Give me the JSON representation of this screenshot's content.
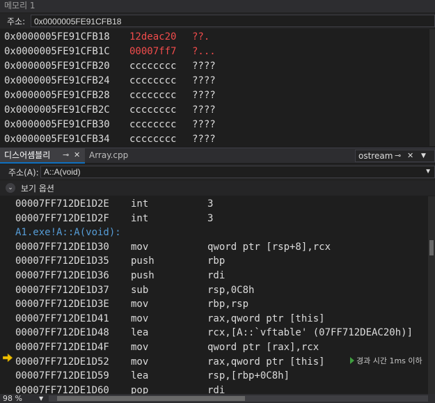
{
  "memory": {
    "title": "메모리 1",
    "address_label": "주소:",
    "address_value": "0x0000005FE91CFB18",
    "rows": [
      {
        "addr": "0x0000005FE91CFB18",
        "hex": "12deac20",
        "ascii": "??.",
        "red": true
      },
      {
        "addr": "0x0000005FE91CFB1C",
        "hex": "00007ff7",
        "ascii": "?...",
        "red": true
      },
      {
        "addr": "0x0000005FE91CFB20",
        "hex": "cccccccc",
        "ascii": "????",
        "red": false
      },
      {
        "addr": "0x0000005FE91CFB24",
        "hex": "cccccccc",
        "ascii": "????",
        "red": false
      },
      {
        "addr": "0x0000005FE91CFB28",
        "hex": "cccccccc",
        "ascii": "????",
        "red": false
      },
      {
        "addr": "0x0000005FE91CFB2C",
        "hex": "cccccccc",
        "ascii": "????",
        "red": false
      },
      {
        "addr": "0x0000005FE91CFB30",
        "hex": "cccccccc",
        "ascii": "????",
        "red": false
      },
      {
        "addr": "0x0000005FE91CFB34",
        "hex": "cccccccc",
        "ascii": "????",
        "red": false
      }
    ]
  },
  "tabs": {
    "disassembly": "디스어셈블리",
    "array": "Array.cpp",
    "ostream": "ostream"
  },
  "disasm": {
    "address_label": "주소(A):",
    "address_value": "A::A(void)",
    "view_options": "보기 옵션",
    "perf_tip": "경과 시간 1ms 이하",
    "rows": [
      {
        "type": "ins",
        "addr": "00007FF712DE1D2E",
        "mn": "int",
        "op": "3"
      },
      {
        "type": "ins",
        "addr": "00007FF712DE1D2F",
        "mn": "int",
        "op": "3"
      },
      {
        "type": "label",
        "text": "A1.exe!A::A(void):"
      },
      {
        "type": "ins",
        "addr": "00007FF712DE1D30",
        "mn": "mov",
        "op": "qword ptr [rsp+8],rcx"
      },
      {
        "type": "ins",
        "addr": "00007FF712DE1D35",
        "mn": "push",
        "op": "rbp"
      },
      {
        "type": "ins",
        "addr": "00007FF712DE1D36",
        "mn": "push",
        "op": "rdi"
      },
      {
        "type": "ins",
        "addr": "00007FF712DE1D37",
        "mn": "sub",
        "op": "rsp,0C8h"
      },
      {
        "type": "ins",
        "addr": "00007FF712DE1D3E",
        "mn": "mov",
        "op": "rbp,rsp"
      },
      {
        "type": "ins",
        "addr": "00007FF712DE1D41",
        "mn": "mov",
        "op": "rax,qword ptr [this]"
      },
      {
        "type": "ins",
        "addr": "00007FF712DE1D48",
        "mn": "lea",
        "op": "rcx,[A::`vftable' (07FF712DEAC20h)]"
      },
      {
        "type": "ins",
        "addr": "00007FF712DE1D4F",
        "mn": "mov",
        "op": "qword ptr [rax],rcx"
      },
      {
        "type": "ins",
        "addr": "00007FF712DE1D52",
        "mn": "mov",
        "op": "rax,qword ptr [this]"
      },
      {
        "type": "ins",
        "addr": "00007FF712DE1D59",
        "mn": "lea",
        "op": "rsp,[rbp+0C8h]"
      },
      {
        "type": "ins",
        "addr": "00007FF712DE1D60",
        "mn": "pop",
        "op": "rdi"
      }
    ]
  },
  "status": {
    "zoom": "98 %"
  },
  "colors": {
    "background": "#1e1e1e",
    "changed_value": "#f14c4c",
    "symbol_label": "#569cd6",
    "exec_arrow": "#f0c000",
    "active_tab_accent": "#0e70c0"
  },
  "icons": {
    "pin": "pin-icon",
    "close": "close-icon",
    "dropdown": "chevron-down-icon",
    "view_options": "chevron-down-icon",
    "current_instruction": "arrow-right-icon"
  }
}
